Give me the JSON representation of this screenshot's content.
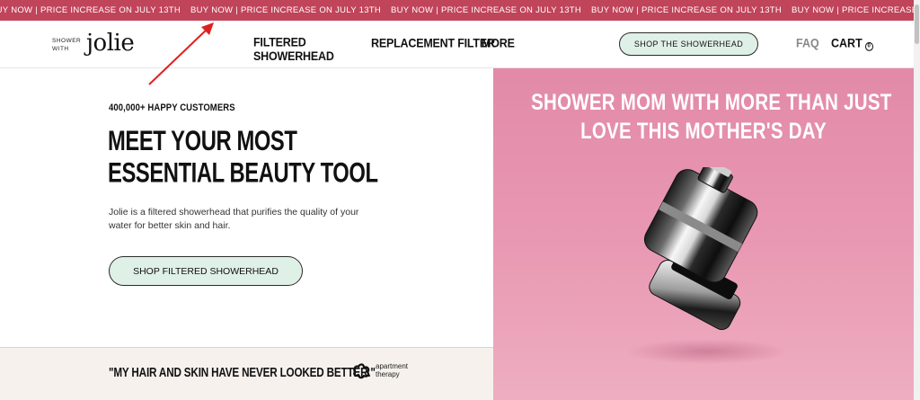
{
  "announcement": {
    "messages": [
      "BUY NOW | PRICE INCREASE ON JULY 13TH",
      "BUY NOW | PRICE INCREASE ON JULY 13TH",
      "BUY NOW | PRICE INCREASE ON JULY 13TH",
      "BUY NOW | PRICE INCREASE ON JULY 13TH",
      "BUY NOW | PRICE INCREASE ON JULY 13TH"
    ],
    "bg_color": "#c0445a"
  },
  "header": {
    "logo_small_line1": "SHOWER",
    "logo_small_line2": "WITH",
    "logo_word": "jolie",
    "nav": [
      "FILTERED SHOWERHEAD",
      "REPLACEMENT FILTER",
      "MORE"
    ],
    "shop_button": "SHOP THE SHOWERHEAD",
    "faq": "FAQ",
    "cart_label": "CART",
    "cart_count": "0"
  },
  "hero": {
    "eyebrow": "400,000+ HAPPY CUSTOMERS",
    "headline_line1": "MEET YOUR MOST",
    "headline_line2": "ESSENTIAL BEAUTY TOOL",
    "description": "Jolie is a filtered showerhead that purifies the quality of your water for better skin and hair.",
    "cta": "SHOP FILTERED SHOWERHEAD",
    "accent_color": "#dff0e6"
  },
  "testimonial": {
    "quote": "\"MY HAIR AND SKIN HAVE NEVER LOOKED BETTER.\"",
    "source_line1": "apartment",
    "source_line2": "therapy"
  },
  "promo": {
    "line1": "SHOWER MOM WITH MORE THAN JUST",
    "line2": "LOVE THIS MOTHER'S DAY",
    "bg_color": "#e28aa8"
  }
}
